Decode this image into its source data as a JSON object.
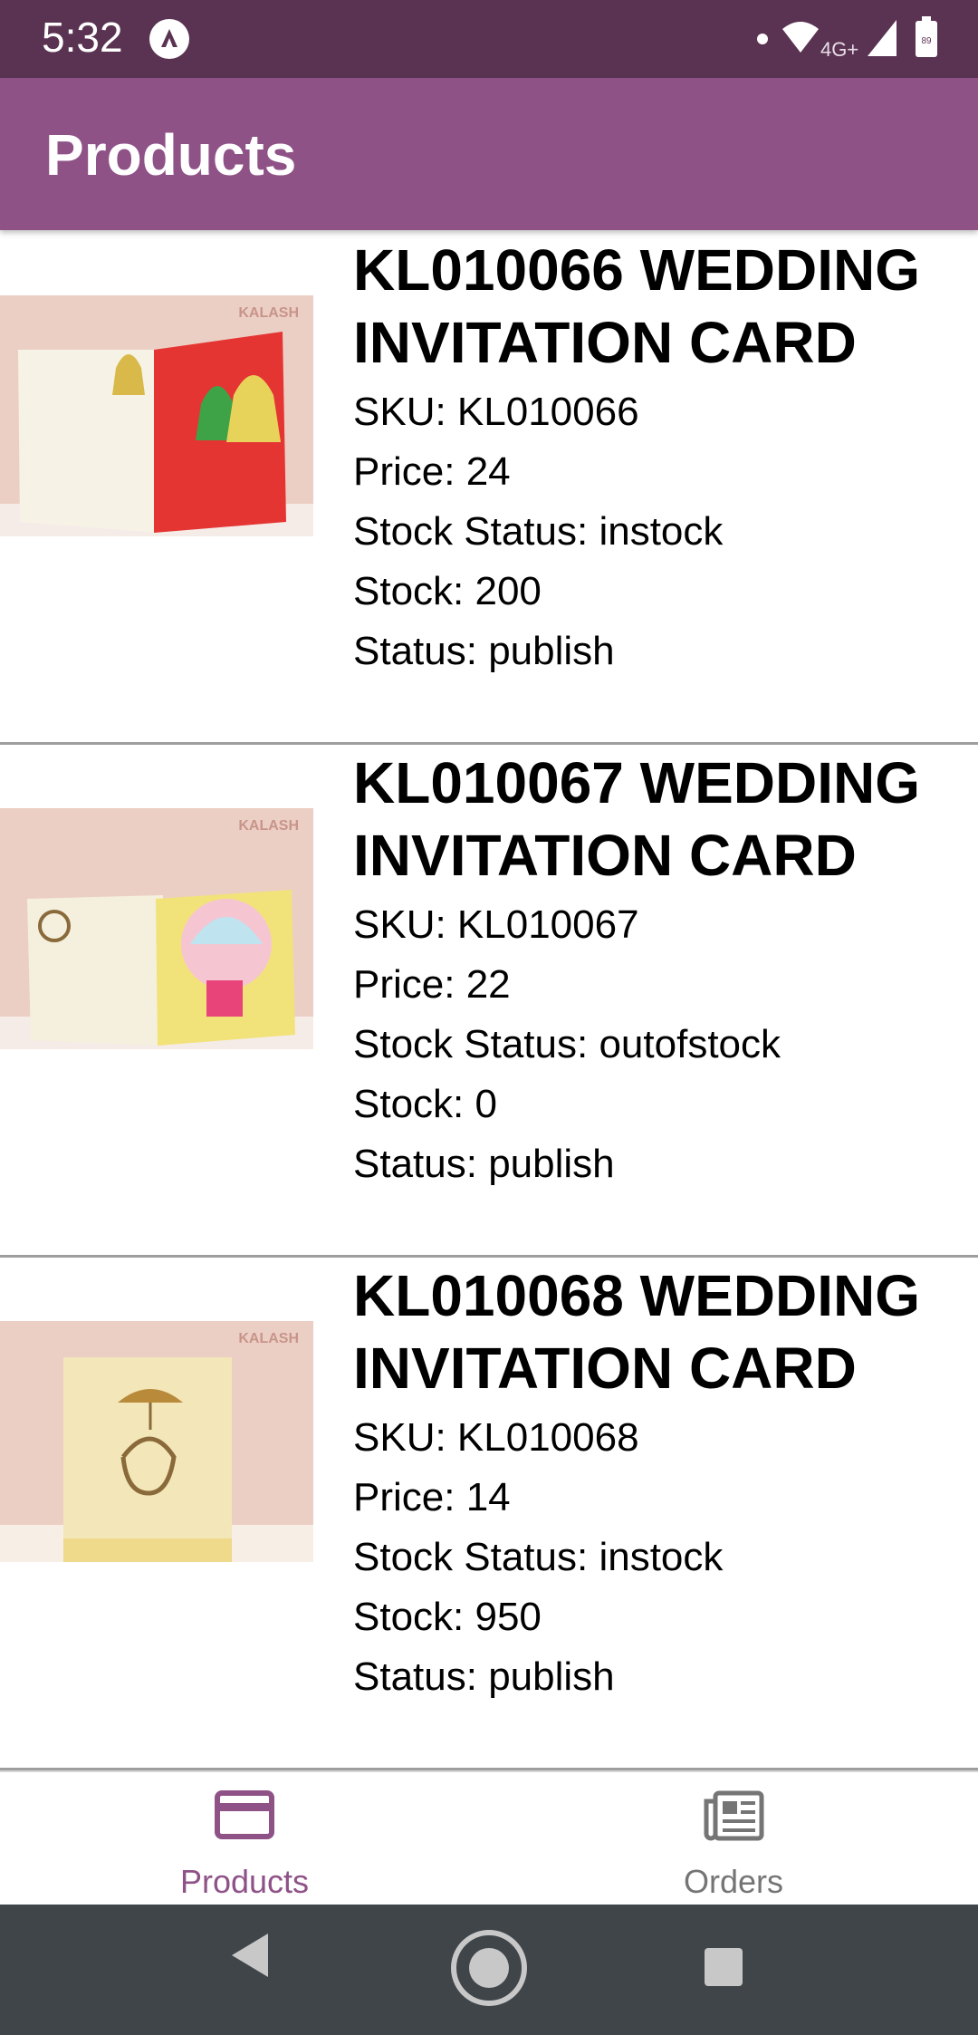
{
  "status_bar": {
    "time": "5:32",
    "network": "4G+",
    "battery": "89"
  },
  "app_bar": {
    "title": "Products"
  },
  "products": [
    {
      "name": "KL010066 WEDDING INVITATION CARD",
      "sku": "SKU: KL010066",
      "price": "Price: 24",
      "stock_status": "Stock Status:  instock",
      "stock": "Stock: 200",
      "status": "Status: publish",
      "thumb_watermark": "KALASH"
    },
    {
      "name": "KL010067 WEDDING INVITATION CARD",
      "sku": "SKU: KL010067",
      "price": "Price: 22",
      "stock_status": "Stock Status:  outofstock",
      "stock": "Stock: 0",
      "status": "Status: publish",
      "thumb_watermark": "KALASH"
    },
    {
      "name": "KL010068 WEDDING INVITATION CARD",
      "sku": "SKU: KL010068",
      "price": "Price: 14",
      "stock_status": "Stock Status:  instock",
      "stock": "Stock: 950",
      "status": "Status: publish",
      "thumb_watermark": "KALASH"
    }
  ],
  "bottom_nav": {
    "items": [
      {
        "label": "Products",
        "icon": "credit-card-icon",
        "active": true
      },
      {
        "label": "Orders",
        "icon": "newspaper-icon",
        "active": false
      }
    ]
  },
  "colors": {
    "status_bar": "#5a3352",
    "app_bar": "#8e5287",
    "accent": "#8e5287",
    "system_nav": "#3f4549"
  }
}
